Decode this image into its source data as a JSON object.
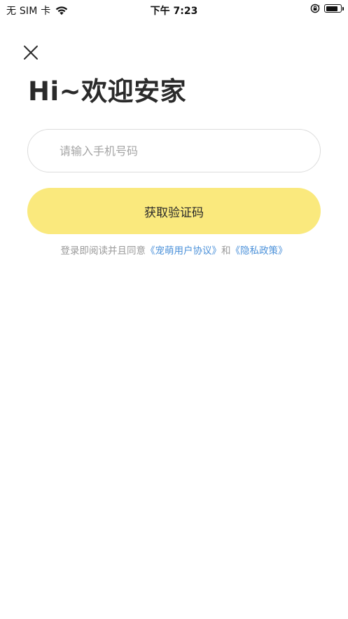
{
  "status_bar": {
    "carrier": "无 SIM 卡",
    "time": "下午 7:23",
    "battery_level": 0.8
  },
  "login": {
    "title": "Hi~欢迎安家",
    "phone_placeholder": "请输入手机号码",
    "get_code_label": "获取验证码",
    "agreement_prefix": "登录即阅读并且同意",
    "user_agreement": "《宠萌用户协议》",
    "conjunction": "和",
    "privacy_policy": "《隐私政策》"
  },
  "colors": {
    "accent_button": "#fae97d",
    "link": "#4a90d9"
  }
}
